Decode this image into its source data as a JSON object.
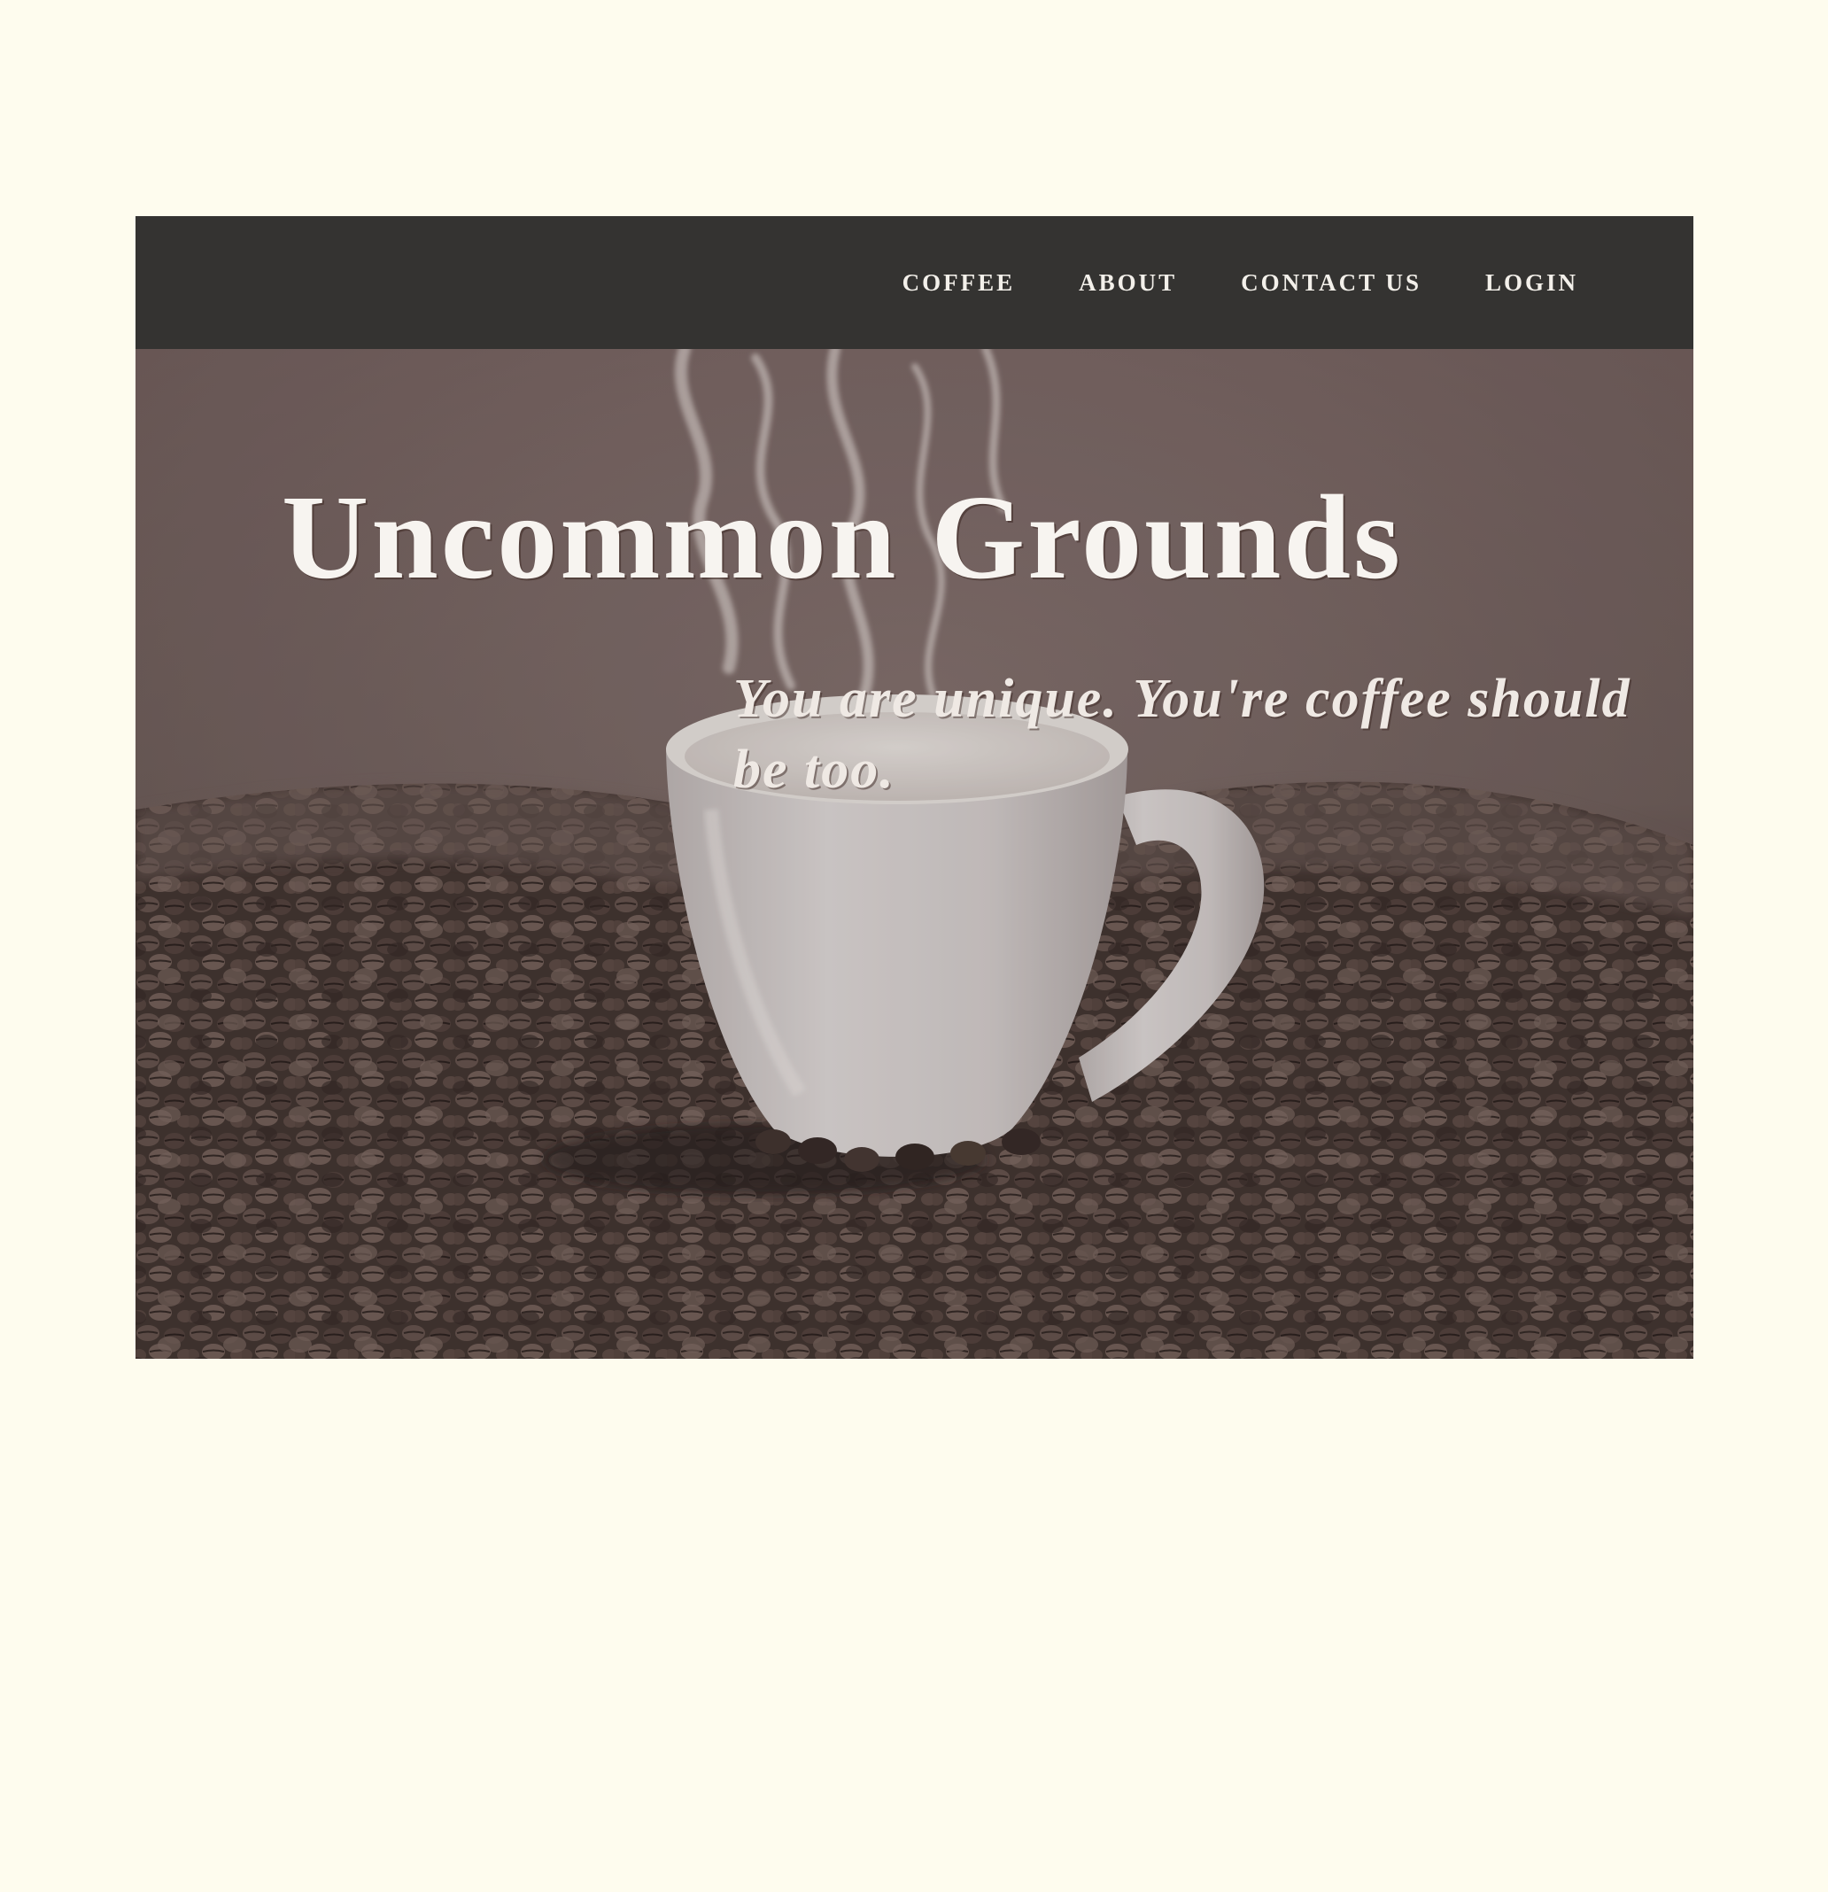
{
  "nav": {
    "items": [
      {
        "label": "COFFEE"
      },
      {
        "label": "ABOUT"
      },
      {
        "label": "CONTACT US"
      },
      {
        "label": "LOGIN"
      }
    ]
  },
  "hero": {
    "title": "Uncommon Grounds",
    "tagline": "You are unique. You're coffee should be too."
  },
  "colors": {
    "page_background": "#fefcee",
    "navbar": "#343331",
    "nav_text": "#f3f0ea",
    "hero_text": "#f7f4f0"
  }
}
